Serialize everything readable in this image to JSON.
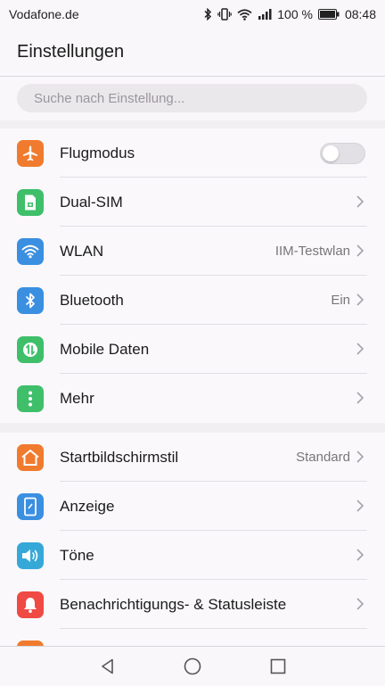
{
  "status_bar": {
    "carrier": "Vodafone.de",
    "battery": "100 %",
    "time": "08:48"
  },
  "header": {
    "title": "Einstellungen"
  },
  "search": {
    "placeholder": "Suche nach Einstellung..."
  },
  "group1": [
    {
      "label": "Flugmodus",
      "icon": "airplane-icon",
      "color": "#f07b2e",
      "toggle": false
    },
    {
      "label": "Dual-SIM",
      "icon": "sim-icon",
      "color": "#3fbf6a"
    },
    {
      "label": "WLAN",
      "icon": "wifi-icon",
      "color": "#3b8fe0",
      "value": "IIM-Testwlan"
    },
    {
      "label": "Bluetooth",
      "icon": "bluetooth-icon",
      "color": "#3b8fe0",
      "value": "Ein"
    },
    {
      "label": "Mobile Daten",
      "icon": "mobile-data-icon",
      "color": "#3fbf6a"
    },
    {
      "label": "Mehr",
      "icon": "more-icon",
      "color": "#3fbf6a"
    }
  ],
  "group2": [
    {
      "label": "Startbildschirmstil",
      "icon": "home-icon",
      "color": "#f07b2e",
      "value": "Standard"
    },
    {
      "label": "Anzeige",
      "icon": "display-icon",
      "color": "#3b8fe0"
    },
    {
      "label": "Töne",
      "icon": "sound-icon",
      "color": "#36a8d8"
    },
    {
      "label": "Benachrichtigungs- & Statusleiste",
      "icon": "notification-icon",
      "color": "#ef4a43"
    }
  ]
}
